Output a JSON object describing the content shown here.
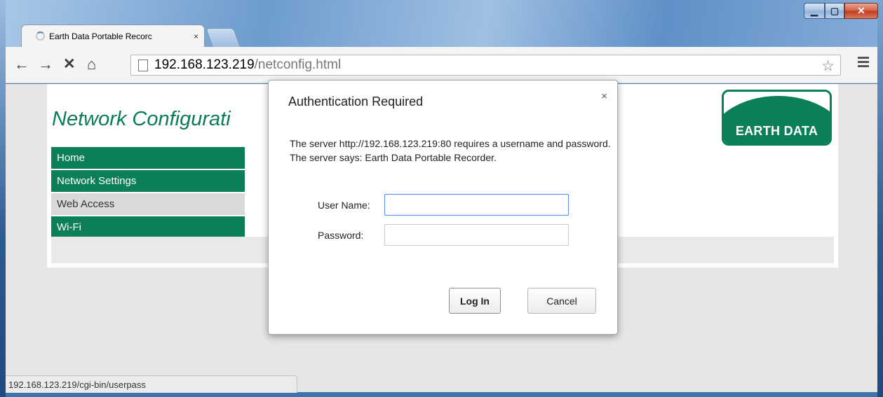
{
  "window": {
    "controls": [
      "minimize",
      "maximize",
      "close"
    ]
  },
  "tab": {
    "title": "Earth Data Portable Recorc",
    "close_glyph": "×"
  },
  "toolbar": {
    "url_host": "192.168.123.219",
    "url_path": "/netconfig.html"
  },
  "page": {
    "title": "Network Configurati",
    "logo_text": "EARTH DATA",
    "nav": [
      {
        "label": "Home"
      },
      {
        "label": "Network Settings"
      },
      {
        "label": "Web Access"
      },
      {
        "label": "Wi-Fi"
      }
    ]
  },
  "dialog": {
    "title": "Authentication Required",
    "close_glyph": "×",
    "message": "The server http://192.168.123.219:80 requires a username and password. The server says: Earth Data Portable Recorder.",
    "username_label": "User Name:",
    "password_label": "Password:",
    "username_value": "",
    "password_value": "",
    "login_label": "Log In",
    "cancel_label": "Cancel"
  },
  "status": {
    "text": "192.168.123.219/cgi-bin/userpass"
  },
  "colors": {
    "brand_green": "#0b7f5a",
    "focus_blue": "#4d90fe"
  }
}
